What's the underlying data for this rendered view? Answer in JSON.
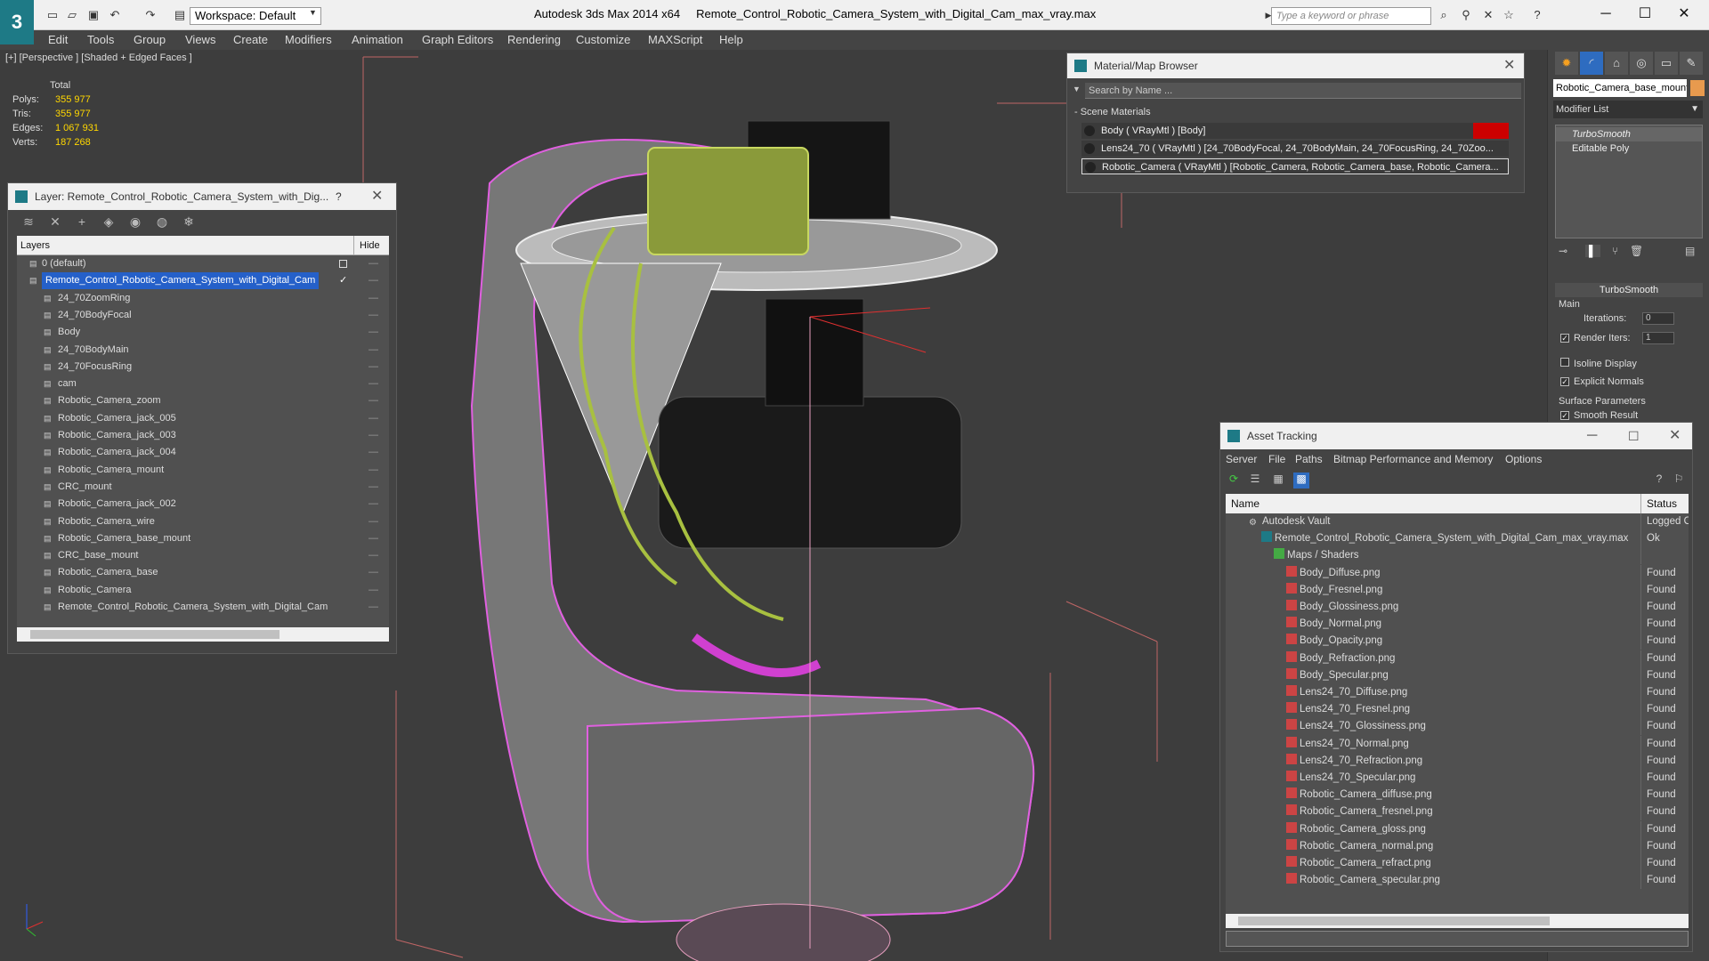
{
  "titlebar": {
    "app_name": "Autodesk 3ds Max  2014 x64",
    "file_name": "Remote_Control_Robotic_Camera_System_with_Digital_Cam_max_vray.max",
    "workspace": "Workspace: Default",
    "search_placeholder": "Type a keyword or phrase",
    "logo": "3"
  },
  "menu": [
    "Edit",
    "Tools",
    "Group",
    "Views",
    "Create",
    "Modifiers",
    "Animation",
    "Graph Editors",
    "Rendering",
    "Customize",
    "MAXScript",
    "Help"
  ],
  "viewport": {
    "label": "[+] [Perspective ] [Shaded + Edged Faces ]",
    "stats": {
      "total_label": "Total",
      "polys_label": "Polys:",
      "polys": "355 977",
      "tris_label": "Tris:",
      "tris": "355 977",
      "edges_label": "Edges:",
      "edges": "1 067 931",
      "verts_label": "Verts:",
      "verts": "187 268"
    }
  },
  "layer_panel": {
    "title": "Layer: Remote_Control_Robotic_Camera_System_with_Dig...",
    "help": "?",
    "col_layers": "Layers",
    "col_hide": "Hide",
    "rows": [
      {
        "name": "0 (default)",
        "indent": 0
      },
      {
        "name": "Remote_Control_Robotic_Camera_System_with_Digital_Cam",
        "indent": 0,
        "selected": true
      },
      {
        "name": "24_70ZoomRing",
        "indent": 1
      },
      {
        "name": "24_70BodyFocal",
        "indent": 1
      },
      {
        "name": "Body",
        "indent": 1
      },
      {
        "name": "24_70BodyMain",
        "indent": 1
      },
      {
        "name": "24_70FocusRing",
        "indent": 1
      },
      {
        "name": "cam",
        "indent": 1
      },
      {
        "name": "Robotic_Camera_zoom",
        "indent": 1
      },
      {
        "name": "Robotic_Camera_jack_005",
        "indent": 1
      },
      {
        "name": "Robotic_Camera_jack_003",
        "indent": 1
      },
      {
        "name": "Robotic_Camera_jack_004",
        "indent": 1
      },
      {
        "name": "Robotic_Camera_mount",
        "indent": 1
      },
      {
        "name": "CRC_mount",
        "indent": 1
      },
      {
        "name": "Robotic_Camera_jack_002",
        "indent": 1
      },
      {
        "name": "Robotic_Camera_wire",
        "indent": 1
      },
      {
        "name": "Robotic_Camera_base_mount",
        "indent": 1
      },
      {
        "name": "CRC_base_mount",
        "indent": 1
      },
      {
        "name": "Robotic_Camera_base",
        "indent": 1
      },
      {
        "name": "Robotic_Camera",
        "indent": 1
      },
      {
        "name": "Remote_Control_Robotic_Camera_System_with_Digital_Cam",
        "indent": 1
      }
    ]
  },
  "material_browser": {
    "title": "Material/Map Browser",
    "search_placeholder": "Search by Name ...",
    "group": "- Scene Materials",
    "rows": [
      {
        "text": "Body  ( VRayMtl ) [Body]"
      },
      {
        "text": "Lens24_70  ( VRayMtl ) [24_70BodyFocal, 24_70BodyMain, 24_70FocusRing, 24_70Zoo..."
      },
      {
        "text": "Robotic_Camera  ( VRayMtl ) [Robotic_Camera, Robotic_Camera_base, Robotic_Camera...",
        "selected": true
      }
    ]
  },
  "command_panel": {
    "object_name": "Robotic_Camera_base_mount",
    "object_color": "#e89a4e",
    "modifier_list": "Modifier List",
    "stack": [
      "TurboSmooth",
      "Editable Poly"
    ],
    "turbosmooth_title": "TurboSmooth",
    "main_label": "Main",
    "iterations_label": "Iterations:",
    "iterations_value": "0",
    "render_iters_label": "Render Iters:",
    "render_iters_value": "1",
    "isoline_label": "Isoline Display",
    "explicit_normals_label": "Explicit Normals",
    "surface_params_label": "Surface Parameters",
    "smooth_result_label": "Smooth Result"
  },
  "asset_tracking": {
    "title": "Asset Tracking",
    "menu": [
      "Server",
      "File",
      "Paths",
      "Bitmap Performance and Memory",
      "Options"
    ],
    "col_name": "Name",
    "col_status": "Status",
    "rows": [
      {
        "name": "Autodesk Vault",
        "status": "Logged Out",
        "level": 0,
        "icon": "vault"
      },
      {
        "name": "Remote_Control_Robotic_Camera_System_with_Digital_Cam_max_vray.max",
        "status": "Ok",
        "level": 1,
        "icon": "max"
      },
      {
        "name": "Maps / Shaders",
        "status": "",
        "level": 2,
        "icon": "maps"
      },
      {
        "name": "Body_Diffuse.png",
        "status": "Found",
        "level": 3,
        "icon": "png"
      },
      {
        "name": "Body_Fresnel.png",
        "status": "Found",
        "level": 3,
        "icon": "png"
      },
      {
        "name": "Body_Glossiness.png",
        "status": "Found",
        "level": 3,
        "icon": "png"
      },
      {
        "name": "Body_Normal.png",
        "status": "Found",
        "level": 3,
        "icon": "png"
      },
      {
        "name": "Body_Opacity.png",
        "status": "Found",
        "level": 3,
        "icon": "png"
      },
      {
        "name": "Body_Refraction.png",
        "status": "Found",
        "level": 3,
        "icon": "png"
      },
      {
        "name": "Body_Specular.png",
        "status": "Found",
        "level": 3,
        "icon": "png"
      },
      {
        "name": "Lens24_70_Diffuse.png",
        "status": "Found",
        "level": 3,
        "icon": "png"
      },
      {
        "name": "Lens24_70_Fresnel.png",
        "status": "Found",
        "level": 3,
        "icon": "png"
      },
      {
        "name": "Lens24_70_Glossiness.png",
        "status": "Found",
        "level": 3,
        "icon": "png"
      },
      {
        "name": "Lens24_70_Normal.png",
        "status": "Found",
        "level": 3,
        "icon": "png"
      },
      {
        "name": "Lens24_70_Refraction.png",
        "status": "Found",
        "level": 3,
        "icon": "png"
      },
      {
        "name": "Lens24_70_Specular.png",
        "status": "Found",
        "level": 3,
        "icon": "png"
      },
      {
        "name": "Robotic_Camera_diffuse.png",
        "status": "Found",
        "level": 3,
        "icon": "png"
      },
      {
        "name": "Robotic_Camera_fresnel.png",
        "status": "Found",
        "level": 3,
        "icon": "png"
      },
      {
        "name": "Robotic_Camera_gloss.png",
        "status": "Found",
        "level": 3,
        "icon": "png"
      },
      {
        "name": "Robotic_Camera_normal.png",
        "status": "Found",
        "level": 3,
        "icon": "png"
      },
      {
        "name": "Robotic_Camera_refract.png",
        "status": "Found",
        "level": 3,
        "icon": "png"
      },
      {
        "name": "Robotic_Camera_specular.png",
        "status": "Found",
        "level": 3,
        "icon": "png"
      }
    ]
  }
}
